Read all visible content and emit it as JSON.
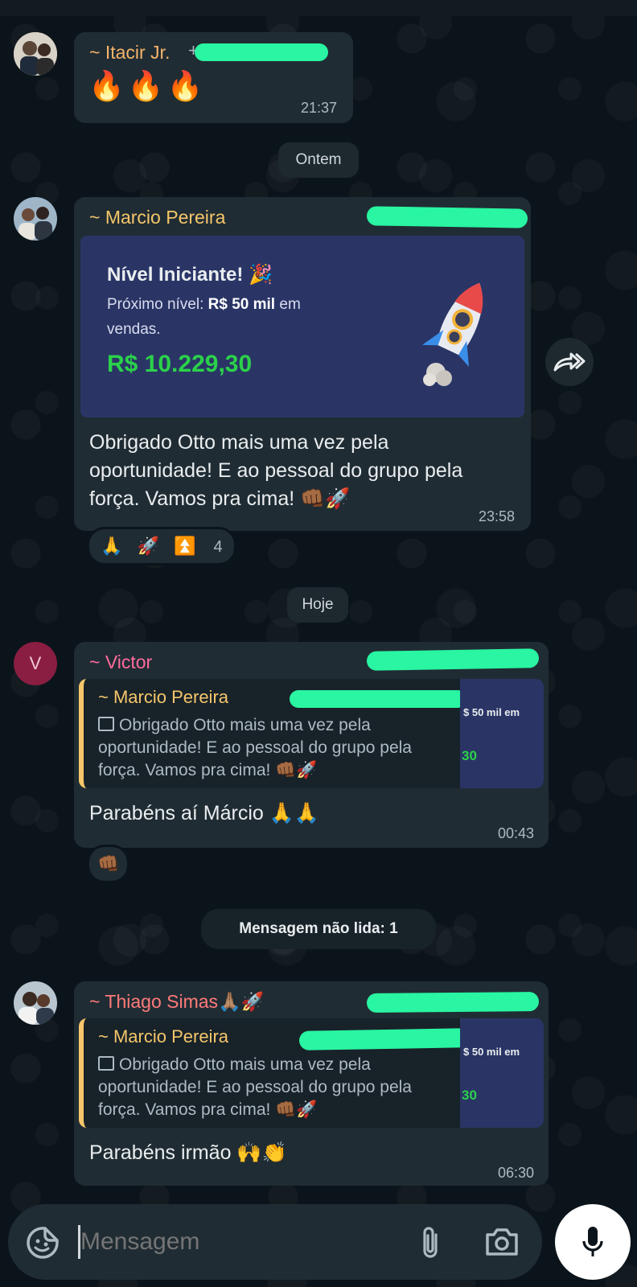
{
  "date_chips": {
    "yesterday": "Ontem",
    "today": "Hoje"
  },
  "unread_banner": "Mensagem não lida: 1",
  "messages": [
    {
      "sender": "~ Itacir Jr.",
      "sender_suffix": "+",
      "text": "🔥🔥🔥",
      "time": "21:37"
    },
    {
      "sender": "~ Marcio Pereira",
      "card": {
        "title": "Nível Iniciante! 🎉",
        "next_label": "Próximo nível: ",
        "next_value": "R$ 50 mil",
        "next_suffix": " em vendas.",
        "amount": "R$ 10.229,30"
      },
      "text": "Obrigado Otto mais uma vez pela oportunidade! E ao pessoal do grupo pela força. Vamos pra cima! 👊🏾🚀",
      "time": "23:58",
      "reactions": "🙏 🚀 ⏫",
      "reaction_count": "4"
    },
    {
      "sender": "~ Victor",
      "avatar_letter": "V",
      "quote": {
        "name": "~ Marcio Pereira",
        "text": "Obrigado Otto mais uma vez pela oportunidade! E ao pessoal do grupo pela força. Vamos pra cima! 👊🏾🚀",
        "thumb_line": "$ 50 mil em",
        "thumb_amount": "30"
      },
      "text": "Parabéns aí Márcio 🙏🙏",
      "time": "00:43",
      "reactions": "👊🏾"
    },
    {
      "sender": "~ Thiago Simas🙏🏽🚀",
      "quote": {
        "name": "~ Marcio Pereira",
        "text": "Obrigado Otto mais uma vez pela oportunidade! E ao pessoal do grupo pela força. Vamos pra cima! 👊🏾🚀",
        "thumb_line": "$ 50 mil em",
        "thumb_amount": "30"
      },
      "text": "Parabéns irmão 🙌👏",
      "time": "06:30"
    }
  ],
  "composer": {
    "placeholder": "Mensagem"
  },
  "colors": {
    "background": "#0b141a",
    "bubble": "#202c33",
    "name_itacir": "#f5b46b",
    "name_marcio": "#f5c66a",
    "name_victor": "#ff6b9d",
    "name_thiago": "#ff7a7a",
    "card_bg": "#2a3566",
    "amount_green": "#2bd14a",
    "mic_button": "#ffffff"
  },
  "icons": [
    "sticker-icon",
    "attach-icon",
    "camera-icon",
    "mic-icon",
    "forward-icon"
  ]
}
